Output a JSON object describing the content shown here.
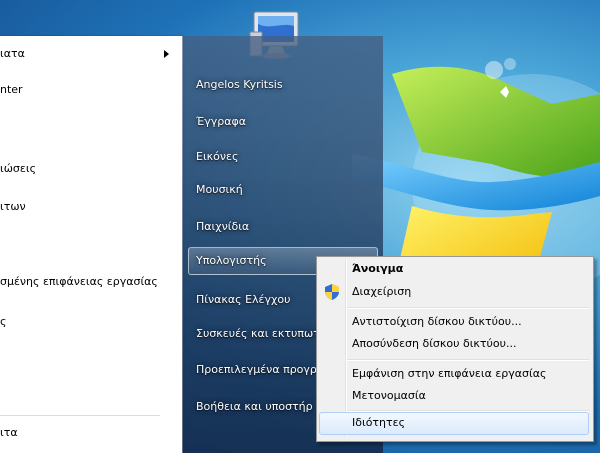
{
  "left_list": {
    "items": [
      {
        "label": "ιατα",
        "has_submenu": true
      },
      {
        "label": "nter"
      },
      {
        "label": "ιώσεις"
      },
      {
        "label": "ιτων"
      },
      {
        "label": "σμένης επιφάνειας εργασίας"
      },
      {
        "label": "ς"
      }
    ],
    "bottom_label": "ιτα"
  },
  "right_list": {
    "items": [
      {
        "label": "Angelos Kyritsis"
      },
      {
        "label": "Έγγραφα"
      },
      {
        "label": "Εικόνες"
      },
      {
        "label": "Μουσική"
      },
      {
        "label": "Παιχνίδια"
      },
      {
        "label": "Υπολογιστής",
        "selected": true
      },
      {
        "label": "Πίνακας Ελέγχου"
      },
      {
        "label": "Συσκευές και εκτυπωτ"
      },
      {
        "label": "Προεπιλεγμένα προγρ"
      },
      {
        "label": "Βοήθεια και υποστήρ"
      }
    ]
  },
  "context_menu": {
    "items": [
      {
        "label": "Άνοιγμα",
        "bold": true
      },
      {
        "label": "Διαχείριση",
        "icon": "uac-shield-icon"
      },
      {
        "label": "Αντιστοίχιση δίσκου δικτύου..."
      },
      {
        "label": "Αποσύνδεση δίσκου δικτύου..."
      },
      {
        "label": "Εμφάνιση στην επιφάνεια εργασίας"
      },
      {
        "label": "Μετονομασία"
      },
      {
        "label": "Ιδιότητες",
        "highlighted": true
      }
    ]
  },
  "colors": {
    "menu_bg": "#f0f0f0",
    "hover_border": "#aecff7",
    "logo_red": "#f35325",
    "logo_green": "#81bc06",
    "logo_blue": "#05a6f0",
    "logo_yellow": "#ffba08"
  }
}
